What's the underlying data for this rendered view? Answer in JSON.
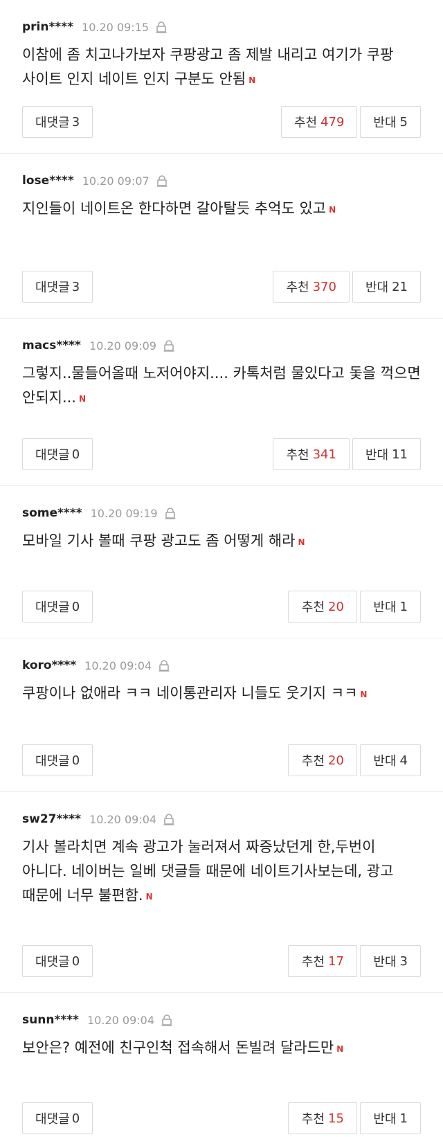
{
  "labels": {
    "reply": "대댓글",
    "up": "추천",
    "down": "반대",
    "badge": "N"
  },
  "comments": [
    {
      "user": "prin****",
      "time": "10.20 09:15",
      "text": "이참에 좀 치고나가보자 쿠팡광고 좀 제발 내리고 여기가 쿠팡 사이트 인지 네이트 인지 구분도 안됨",
      "replies": "3",
      "up": "479",
      "down": "5"
    },
    {
      "user": "lose****",
      "time": "10.20 09:07",
      "text": "지인들이 네이트온 한다하면 갈아탈듯 추억도 있고",
      "replies": "3",
      "up": "370",
      "down": "21"
    },
    {
      "user": "macs****",
      "time": "10.20 09:09",
      "text": "그렇지..물들어올때 노저어야지.... 카톡처럼 물있다고 돛을 꺽으면 안되지...",
      "replies": "0",
      "up": "341",
      "down": "11"
    },
    {
      "user": "some****",
      "time": "10.20 09:19",
      "text": "모바일 기사 볼때 쿠팡 광고도 좀 어떻게 해라",
      "replies": "0",
      "up": "20",
      "down": "1"
    },
    {
      "user": "koro****",
      "time": "10.20 09:04",
      "text": "쿠팡이나 없애라 ㅋㅋ 네이통관리자 니들도 웃기지 ㅋㅋ",
      "replies": "0",
      "up": "20",
      "down": "4"
    },
    {
      "user": "sw27****",
      "time": "10.20 09:04",
      "text": "기사 볼라치면 계속 광고가 눌러져서 짜증났던게 한,두번이 아니다. 네이버는 일베 댓글들 때문에 네이트기사보는데, 광고 때문에 너무 불편함.",
      "replies": "0",
      "up": "17",
      "down": "3"
    },
    {
      "user": "sunn****",
      "time": "10.20 09:04",
      "text": "보안은? 예전에 친구인척 접속해서 돈빌려 달라드만",
      "replies": "0",
      "up": "15",
      "down": "1"
    }
  ]
}
